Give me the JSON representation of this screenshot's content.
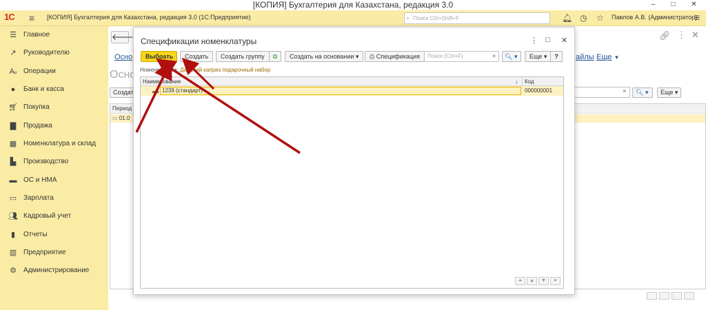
{
  "window": {
    "title": "[КОПИЯ] Бухгалтерия для Казахстана, редакция 3.0",
    "minimize": "–",
    "maximize": "□",
    "close": "✕"
  },
  "app": {
    "logo": "1С",
    "title": "[КОПИЯ] Бухгалтерия для Казахстана, редакция 3.0  (1С:Предприятие)",
    "search_placeholder": "Поиск Ctrl+Shift+F",
    "user": "Павлов А.В. (Администратор)"
  },
  "sidebar": {
    "items": [
      {
        "label": "Главное",
        "icon": "list-icon"
      },
      {
        "label": "Руководителю",
        "icon": "chart-icon"
      },
      {
        "label": "Операции",
        "icon": "operations-icon"
      },
      {
        "label": "Банк и касса",
        "icon": "bank-icon"
      },
      {
        "label": "Покупка",
        "icon": "cart-icon"
      },
      {
        "label": "Продажа",
        "icon": "bag-icon"
      },
      {
        "label": "Номенклатура и склад",
        "icon": "warehouse-icon"
      },
      {
        "label": "Производство",
        "icon": "factory-icon"
      },
      {
        "label": "ОС и НМА",
        "icon": "truck-icon"
      },
      {
        "label": "Зарплата",
        "icon": "salary-icon"
      },
      {
        "label": "Кадровый учет",
        "icon": "people-icon"
      },
      {
        "label": "Отчеты",
        "icon": "reports-icon"
      },
      {
        "label": "Предприятие",
        "icon": "enterprise-icon"
      },
      {
        "label": "Администрирование",
        "icon": "gear-icon"
      }
    ]
  },
  "background_form": {
    "tab_left": "Осно",
    "tab_right": "айлы",
    "more": "Еще",
    "title": "Осно",
    "create": "Создат",
    "column_period": "Период",
    "row_period": "01.0",
    "more_button": "Еще"
  },
  "dialog": {
    "title": "Спецификации номенклатуры",
    "toolbar": {
      "select": "Выбрать",
      "create": "Создать",
      "create_group": "Создать группу",
      "create_based_on": "Создать на основании",
      "specification": "Спецификация",
      "search_placeholder": "Поиск (Ctrl+F)",
      "more": "Еще",
      "help": "?"
    },
    "filter_label": "Номенклатура:",
    "filter_value": "Дамский каприз подарочный набор",
    "columns": {
      "name": "Наименование",
      "code": "Код"
    },
    "rows": [
      {
        "name": "1239 (стандарт)",
        "code": "000000001"
      }
    ]
  }
}
